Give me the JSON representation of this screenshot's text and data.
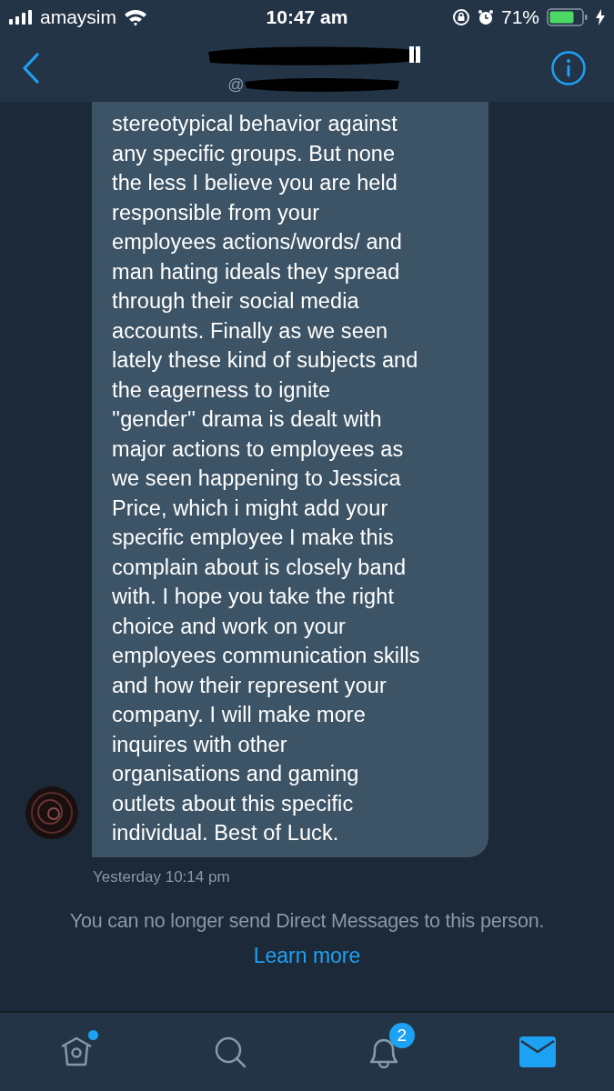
{
  "status_bar": {
    "carrier": "amaysim",
    "time": "10:47 am",
    "battery": "71%"
  },
  "header": {
    "handle": "@",
    "redacted": true
  },
  "message": {
    "text": "stereotypical behavior against\nany specific groups. But none\nthe less I believe you are held\nresponsible from your\nemployees actions/words/ and\nman hating ideals they spread\nthrough their social media\naccounts. Finally as we seen\nlately these kind of subjects and\nthe eagerness to ignite\n''gender'' drama is dealt with\nmajor actions to employees as\nwe seen happening to Jessica\nPrice, which i might add your\nspecific employee I make this\ncomplain about is closely band\nwith. I hope you take the right\nchoice and work on your\nemployees communication skills\nand how their represent your\ncompany. I will make more\ninquires with other\norganisations and gaming\noutlets about this specific\nindividual. Best of Luck.",
    "timestamp": "Yesterday 10:14 pm"
  },
  "notice": {
    "text": "You can no longer send Direct Messages to this person.",
    "link": "Learn more"
  },
  "tab_bar": [
    {
      "kind": "home",
      "selected": false,
      "dot": true
    },
    {
      "kind": "search",
      "selected": false
    },
    {
      "kind": "notifications",
      "selected": false,
      "badge": "2"
    },
    {
      "kind": "messages",
      "selected": true
    }
  ]
}
